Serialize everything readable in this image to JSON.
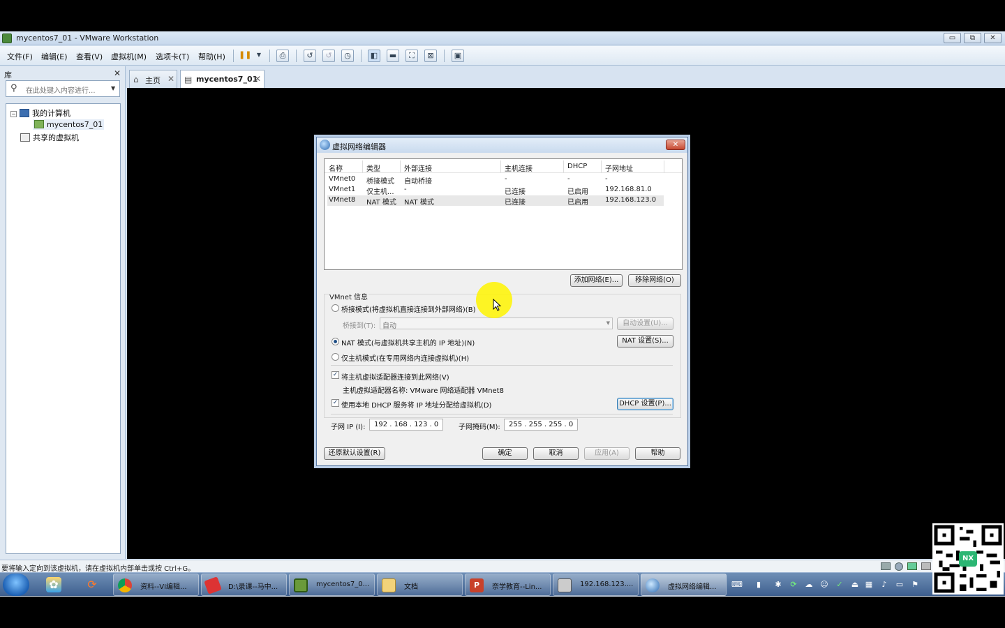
{
  "window": {
    "title": "mycentos7_01 - VMware Workstation",
    "minimize": "▭",
    "restore": "⧉",
    "close": "✕"
  },
  "menu": [
    "文件(F)",
    "编辑(E)",
    "查看(V)",
    "虚拟机(M)",
    "选项卡(T)",
    "帮助(H)"
  ],
  "library": {
    "header": "库",
    "close": "✕",
    "search_placeholder": "在此处键入内容进行...",
    "tree": {
      "my_computer": "我的计算机",
      "vm": "mycentos7_01",
      "shared": "共享的虚拟机"
    }
  },
  "tabs": {
    "home": "主页",
    "vm": "mycentos7_01"
  },
  "status_text": "要将输入定向到该虚拟机，请在虚拟机内部单击或按 Ctrl+G。",
  "taskbar": {
    "tasks": [
      "资料--VI编辑...",
      "D:\\录课--马中...",
      "mycentos7_0...",
      "文档",
      "奈学教育--Lin...",
      "192.168.123....",
      "虚拟网络编辑..."
    ]
  },
  "qr_badge": "NX",
  "dialog": {
    "title": "虚拟网络编辑器",
    "close": "✕",
    "columns": [
      "名称",
      "类型",
      "外部连接",
      "主机连接",
      "DHCP",
      "子网地址"
    ],
    "networks": [
      {
        "name": "VMnet0",
        "type": "桥接模式",
        "external": "自动桥接",
        "host": "-",
        "dhcp": "-",
        "subnet": "-"
      },
      {
        "name": "VMnet1",
        "type": "仅主机...",
        "external": "-",
        "host": "已连接",
        "dhcp": "已启用",
        "subnet": "192.168.81.0"
      },
      {
        "name": "VMnet8",
        "type": "NAT 模式",
        "external": "NAT 模式",
        "host": "已连接",
        "dhcp": "已启用",
        "subnet": "192.168.123.0"
      }
    ],
    "add_network": "添加网络(E)...",
    "remove_network": "移除网络(O)",
    "vmnet_info_label": "VMnet 信息",
    "bridge_mode": "桥接模式(将虚拟机直接连接到外部网络)(B)",
    "bridge_to_label": "桥接到(T):",
    "bridge_to_value": "自动",
    "auto_settings": "自动设置(U)...",
    "nat_mode": "NAT 模式(与虚拟机共享主机的 IP 地址)(N)",
    "nat_settings": "NAT 设置(S)...",
    "host_only": "仅主机模式(在专用网络内连接虚拟机)(H)",
    "connect_adapter": "将主机虚拟适配器连接到此网络(V)",
    "adapter_name": "主机虚拟适配器名称: VMware 网络适配器 VMnet8",
    "use_dhcp": "使用本地 DHCP 服务将 IP 地址分配给虚拟机(D)",
    "dhcp_settings": "DHCP 设置(P)...",
    "subnet_ip_label": "子网 IP (I):",
    "subnet_ip": "192 . 168 . 123 .  0",
    "subnet_mask_label": "子网掩码(M):",
    "subnet_mask": "255 . 255 . 255 .  0",
    "restore_defaults": "还原默认设置(R)",
    "ok": "确定",
    "cancel": "取消",
    "apply": "应用(A)",
    "help": "帮助"
  }
}
